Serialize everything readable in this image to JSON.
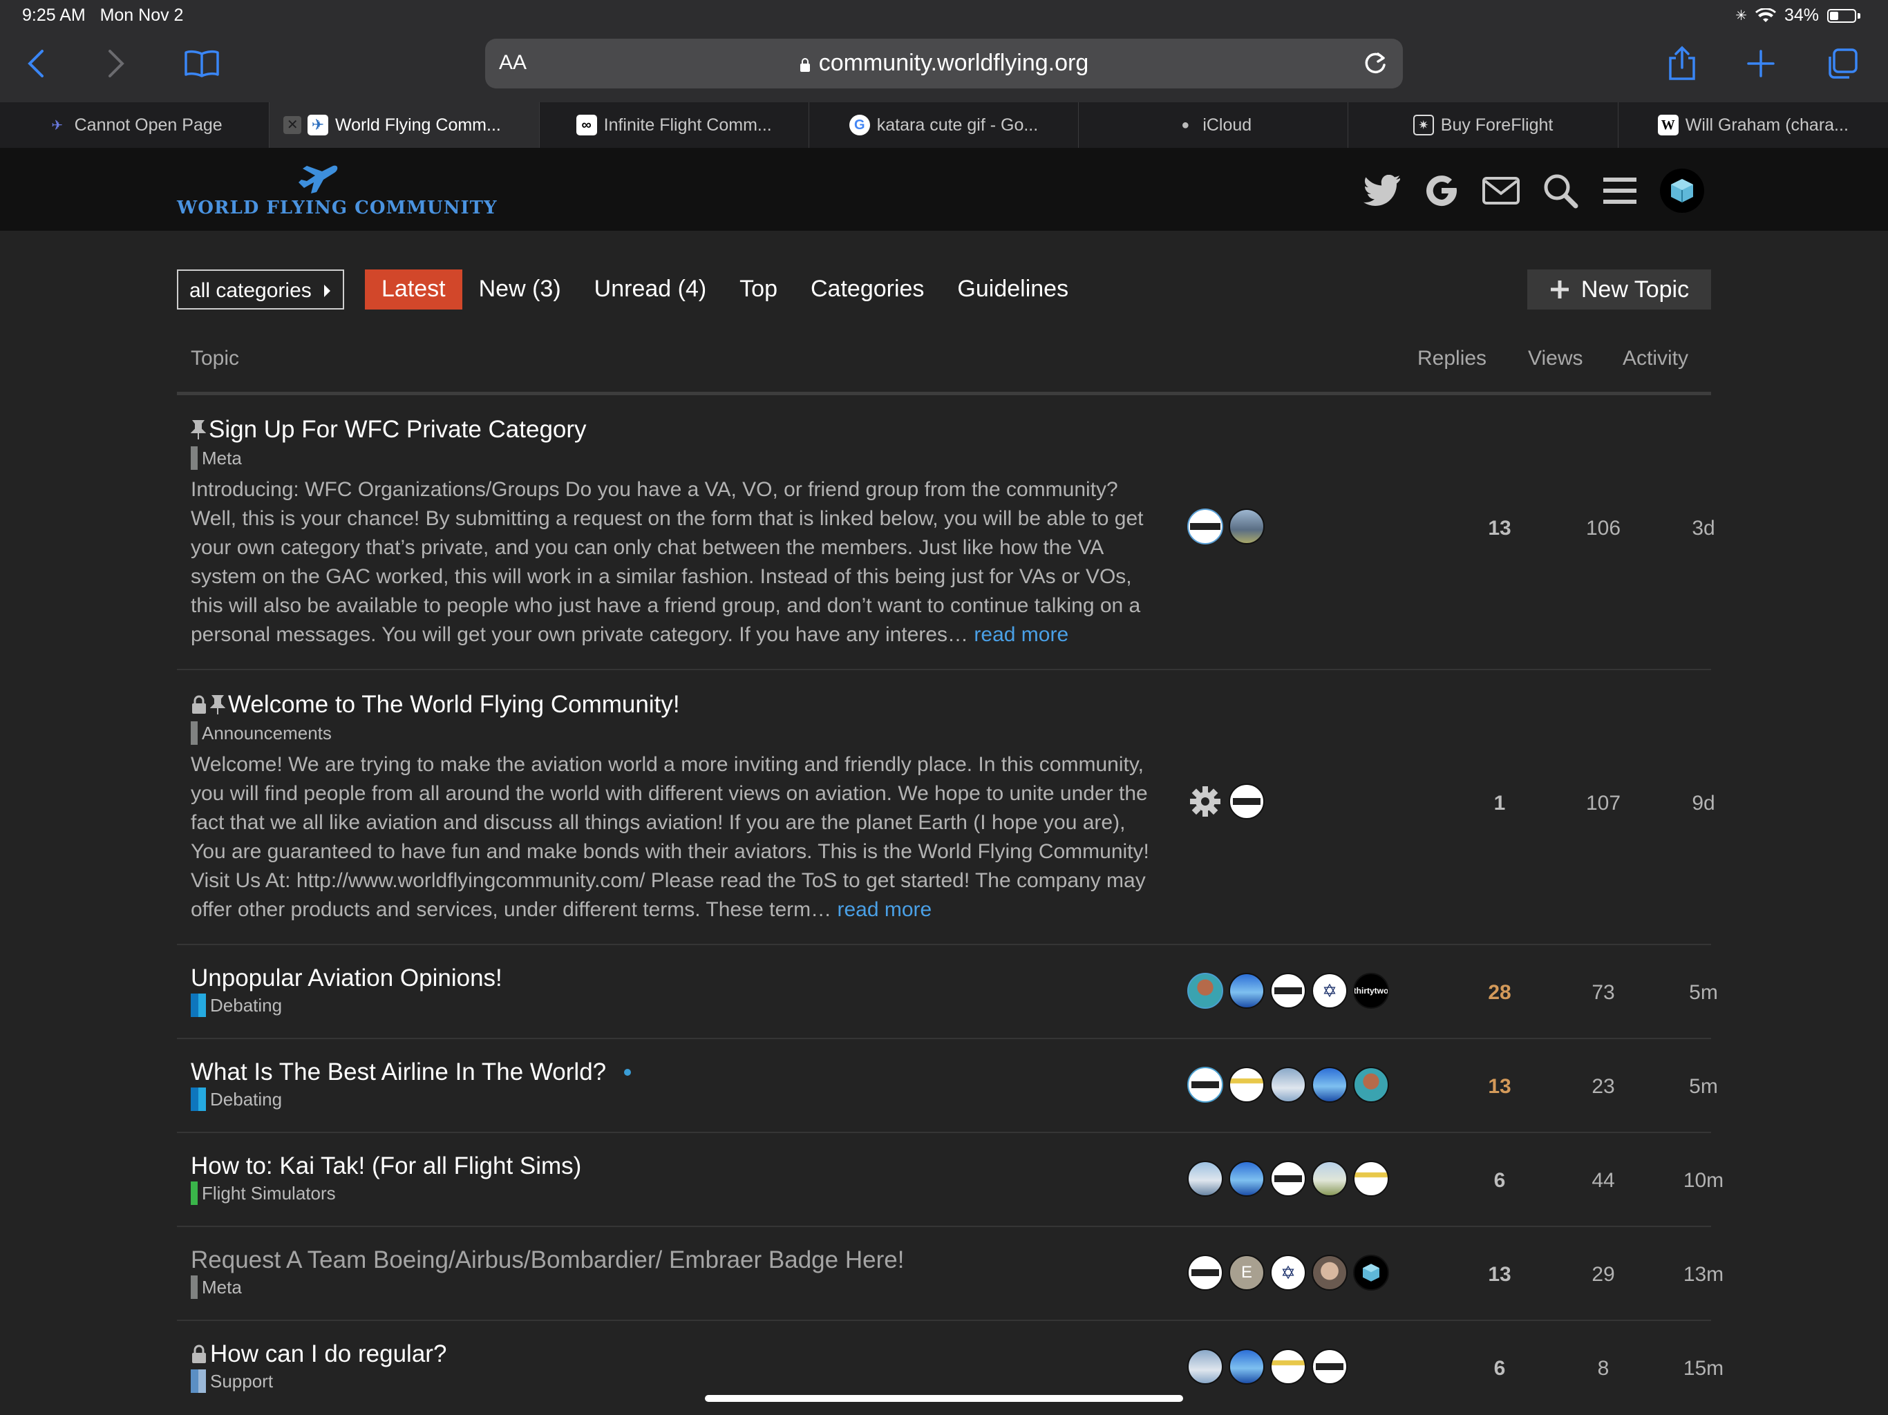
{
  "status": {
    "time": "9:25 AM",
    "date": "Mon Nov 2",
    "battery": "34%"
  },
  "browser": {
    "aa_label": "AA",
    "url": "community.worldflying.org",
    "tabs": [
      {
        "label": "Cannot Open Page",
        "icon": "plane-favicon",
        "active": false
      },
      {
        "label": "World Flying Comm...",
        "icon": "wfc-favicon",
        "active": true
      },
      {
        "label": "Infinite Flight Comm...",
        "icon": "infinite-flight-favicon",
        "active": false
      },
      {
        "label": "katara cute gif - Go...",
        "icon": "google-favicon",
        "active": false
      },
      {
        "label": "iCloud",
        "icon": "apple-favicon",
        "active": false
      },
      {
        "label": "Buy ForeFlight",
        "icon": "foreflight-favicon",
        "active": false
      },
      {
        "label": "Will Graham (chara...",
        "icon": "wikipedia-favicon",
        "active": false
      }
    ]
  },
  "site": {
    "logo_text": "WORLD FLYING COMMUNITY"
  },
  "nav": {
    "category_select": "all categories",
    "pills": [
      "Latest",
      "New (3)",
      "Unread (4)",
      "Top",
      "Categories",
      "Guidelines"
    ],
    "new_topic": "New Topic"
  },
  "table": {
    "headers": {
      "topic": "Topic",
      "replies": "Replies",
      "views": "Views",
      "activity": "Activity"
    },
    "read_more": "read more",
    "topics": [
      {
        "title": "Sign Up For WFC Private Category",
        "category": "Meta",
        "excerpt": "Introducing: WFC Organizations/Groups Do you have a VA, VO, or friend group from the community? Well, this is your chance! By submitting a request on the form that is linked below, you will be able to get your own category that’s private, and you can only chat between the members. Just like how the VA system on the GAC worked, this will work in a similar fashion. Instead of this being just for VAs or VOs, this will also be available to people who just have a friend group, and don’t want to continue talking on a personal messages. You will get your own private category. If you have any interes…",
        "replies": "13",
        "views": "106",
        "activity": "3d"
      },
      {
        "title": "Welcome to The World Flying Community!",
        "category": "Announcements",
        "excerpt": "Welcome! We are trying to make the aviation world a more inviting and friendly place. In this community, you will find people from all around the world with different views on aviation. We hope to unite under the fact that we all like aviation and discuss all things aviation! If you are the planet Earth (I hope you are), You are guaranteed to have fun and make bonds with their aviators. This is the World Flying Community! Visit Us At: http://www.worldflyingcommunity.com/ Please read the ToS to get started! The company may offer other products and services, under different terms. These term…",
        "replies": "1",
        "views": "107",
        "activity": "9d"
      },
      {
        "title": "Unpopular Aviation Opinions!",
        "category": "Debating",
        "replies": "28",
        "views": "73",
        "activity": "5m"
      },
      {
        "title": "What Is The Best Airline In The World?",
        "category": "Debating",
        "replies": "13",
        "views": "23",
        "activity": "5m"
      },
      {
        "title": "How to: Kai Tak! (For all Flight Sims)",
        "category": "Flight Simulators",
        "replies": "6",
        "views": "44",
        "activity": "10m"
      },
      {
        "title": "Request A Team Boeing/Airbus/Bombardier/ Embraer Badge Here!",
        "category": "Meta",
        "replies": "13",
        "views": "29",
        "activity": "13m"
      },
      {
        "title": "How can I do regular?",
        "category": "Support",
        "replies": "6",
        "views": "8",
        "activity": "15m"
      }
    ],
    "avatar_letter": "E",
    "avatar_text": "thirtytwo"
  },
  "colors": {
    "accent_latest": "#d2472a",
    "link": "#4aa0e6",
    "hot_replies": "#d49a5a",
    "cat_meta": "#808281",
    "cat_debating_a": "#0e76bd",
    "cat_debating_b": "#25aae1",
    "cat_flight_sims": "#3ab54a",
    "cat_support": "#5b8fc4"
  }
}
